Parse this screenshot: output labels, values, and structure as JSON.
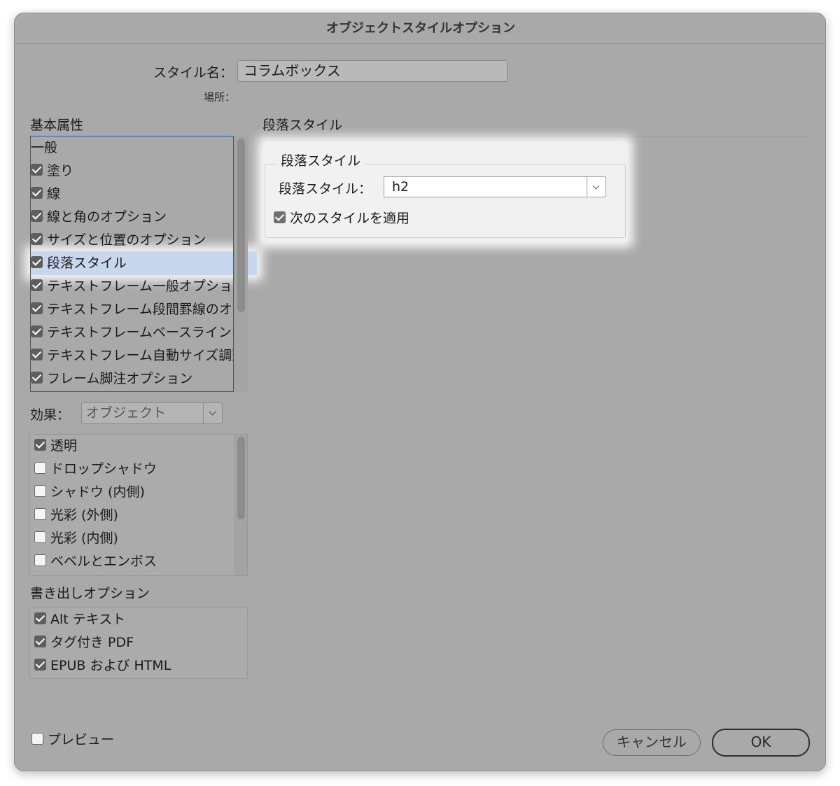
{
  "window": {
    "title": "オブジェクトスタイルオプション"
  },
  "style_name": {
    "label": "スタイル名：",
    "value": "コラムボックス"
  },
  "location": {
    "label": "場所："
  },
  "basic_attributes": {
    "heading": "基本属性",
    "items": [
      {
        "label": "一般",
        "checkbox": false,
        "checked": false,
        "selected": false
      },
      {
        "label": "塗り",
        "checkbox": true,
        "checked": true,
        "selected": false
      },
      {
        "label": "線",
        "checkbox": true,
        "checked": true,
        "selected": false
      },
      {
        "label": "線と角のオプション",
        "checkbox": true,
        "checked": true,
        "selected": false
      },
      {
        "label": "サイズと位置のオプション",
        "checkbox": true,
        "checked": true,
        "selected": false
      },
      {
        "label": "段落スタイル",
        "checkbox": true,
        "checked": true,
        "selected": true
      },
      {
        "label": "テキストフレーム一般オプション",
        "checkbox": true,
        "checked": true,
        "selected": false
      },
      {
        "label": "テキストフレーム段間罫線のオプション",
        "checkbox": true,
        "checked": true,
        "selected": false
      },
      {
        "label": "テキストフレームベースラインオプション",
        "checkbox": true,
        "checked": true,
        "selected": false
      },
      {
        "label": "テキストフレーム自動サイズ調整オプション",
        "checkbox": true,
        "checked": true,
        "selected": false
      },
      {
        "label": "フレーム脚注オプション",
        "checkbox": true,
        "checked": true,
        "selected": false
      }
    ]
  },
  "effects": {
    "label": "効果：",
    "target_value": "オブジェクト",
    "items": [
      {
        "label": "透明",
        "checked": true
      },
      {
        "label": "ドロップシャドウ",
        "checked": false
      },
      {
        "label": "シャドウ (内側)",
        "checked": false
      },
      {
        "label": "光彩 (外側)",
        "checked": false
      },
      {
        "label": "光彩 (内側)",
        "checked": false
      },
      {
        "label": "ベベルとエンボス",
        "checked": false
      }
    ]
  },
  "export_options": {
    "heading": "書き出しオプション",
    "items": [
      {
        "label": "Alt テキスト",
        "checked": true
      },
      {
        "label": "タグ付き PDF",
        "checked": true
      },
      {
        "label": "EPUB および HTML",
        "checked": true
      }
    ]
  },
  "paragraph_panel": {
    "section_title": "段落スタイル",
    "group_title": "段落スタイル",
    "style_label": "段落スタイル：",
    "style_value": "h2",
    "apply_next_label": "次のスタイルを適用",
    "apply_next_checked": true
  },
  "footer": {
    "preview_label": "プレビュー",
    "preview_checked": false,
    "cancel_label": "キャンセル",
    "ok_label": "OK"
  }
}
